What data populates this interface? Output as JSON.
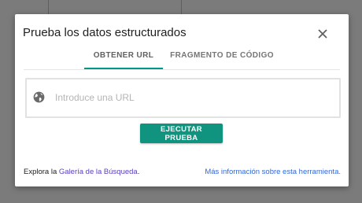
{
  "dialog": {
    "title": "Prueba los datos estructurados",
    "close_icon": "close-icon"
  },
  "tabs": [
    {
      "label": "OBTENER URL",
      "active": true
    },
    {
      "label": "FRAGMENTO DE CÓDIGO",
      "active": false
    }
  ],
  "url_input": {
    "placeholder": "Introduce una URL",
    "value": "",
    "icon": "globe-icon"
  },
  "run_button": {
    "label": "EJECUTAR PRUEBA"
  },
  "footer": {
    "explore_prefix": "Explora la ",
    "gallery_link": "Galería de la Búsqueda",
    "explore_suffix": ".",
    "more_info_link": "Más información sobre esta herramienta."
  },
  "colors": {
    "accent": "#009688",
    "button": "#10947f",
    "link": "#3367d6",
    "overlay": "#7b7b7b"
  }
}
